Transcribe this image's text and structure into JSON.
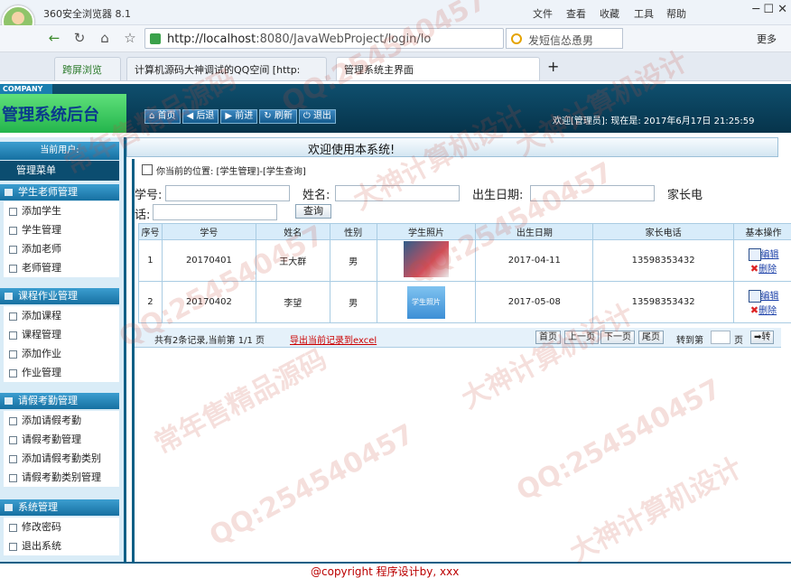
{
  "browser": {
    "title": "360安全浏览器 8.1",
    "menu": [
      "文件",
      "查看",
      "收藏",
      "工具",
      "帮助"
    ],
    "url_host": "http://localhost",
    "url_rest": ":8080/JavaWebProject/login/lo",
    "search": "发短信怂恿男",
    "more": "更多",
    "tabs": [
      "跨屏浏览",
      "计算机源码大神调试的QQ空间 [http:",
      "管理系统主界面"
    ]
  },
  "header": {
    "company": "COMPANY",
    "system_name": "管理系统后台",
    "toolbar": [
      "首页",
      "后退",
      "前进",
      "刷新",
      "退出"
    ],
    "welcome": "欢迎[管理员]:   现在是: 2017年6月17日 21:25:59"
  },
  "sidebar": {
    "current_user": "当前用户:",
    "menu_title": "管理菜单",
    "groups": [
      {
        "title": "学生老师管理",
        "items": [
          "添加学生",
          "学生管理",
          "添加老师",
          "老师管理"
        ]
      },
      {
        "title": "课程作业管理",
        "items": [
          "添加课程",
          "课程管理",
          "添加作业",
          "作业管理"
        ]
      },
      {
        "title": "请假考勤管理",
        "items": [
          "添加请假考勤",
          "请假考勤管理",
          "添加请假考勤类别",
          "请假考勤类别管理"
        ]
      },
      {
        "title": "系统管理",
        "items": [
          "修改密码",
          "退出系统"
        ]
      }
    ]
  },
  "main": {
    "welcome": "欢迎使用本系统!",
    "location": "你当前的位置: [学生管理]-[学生查询]",
    "filters": {
      "student_no": "学号:",
      "name": "姓名:",
      "birth": "出生日期:",
      "phone_a": "家长电",
      "phone_b": "话:",
      "query": "查询"
    },
    "columns": [
      "序号",
      "学号",
      "姓名",
      "性别",
      "学生照片",
      "出生日期",
      "家长电话",
      "基本操作"
    ],
    "rows": [
      {
        "idx": "1",
        "no": "20170401",
        "name": "王大群",
        "sex": "男",
        "photo": "",
        "birth": "2017-04-11",
        "phone": "13598353432",
        "edit": "编辑",
        "del": "删除"
      },
      {
        "idx": "2",
        "no": "20170402",
        "name": "李望",
        "sex": "男",
        "photo": "学生照片",
        "birth": "2017-05-08",
        "phone": "13598353432",
        "edit": "编辑",
        "del": "删除"
      }
    ],
    "pager": {
      "info": "共有2条记录,当前第 1/1 页",
      "export": "导出当前记录到excel",
      "first": "首页",
      "prev": "上一页",
      "next": "下一页",
      "last": "尾页",
      "goto": "转到第",
      "page": "页",
      "go": "转"
    }
  },
  "footer": {
    "copyright": "@copyright 程序设计by, xxx"
  },
  "watermarks": [
    "QQ:254540457",
    "常年售精品源码",
    "大神计算机设计"
  ]
}
